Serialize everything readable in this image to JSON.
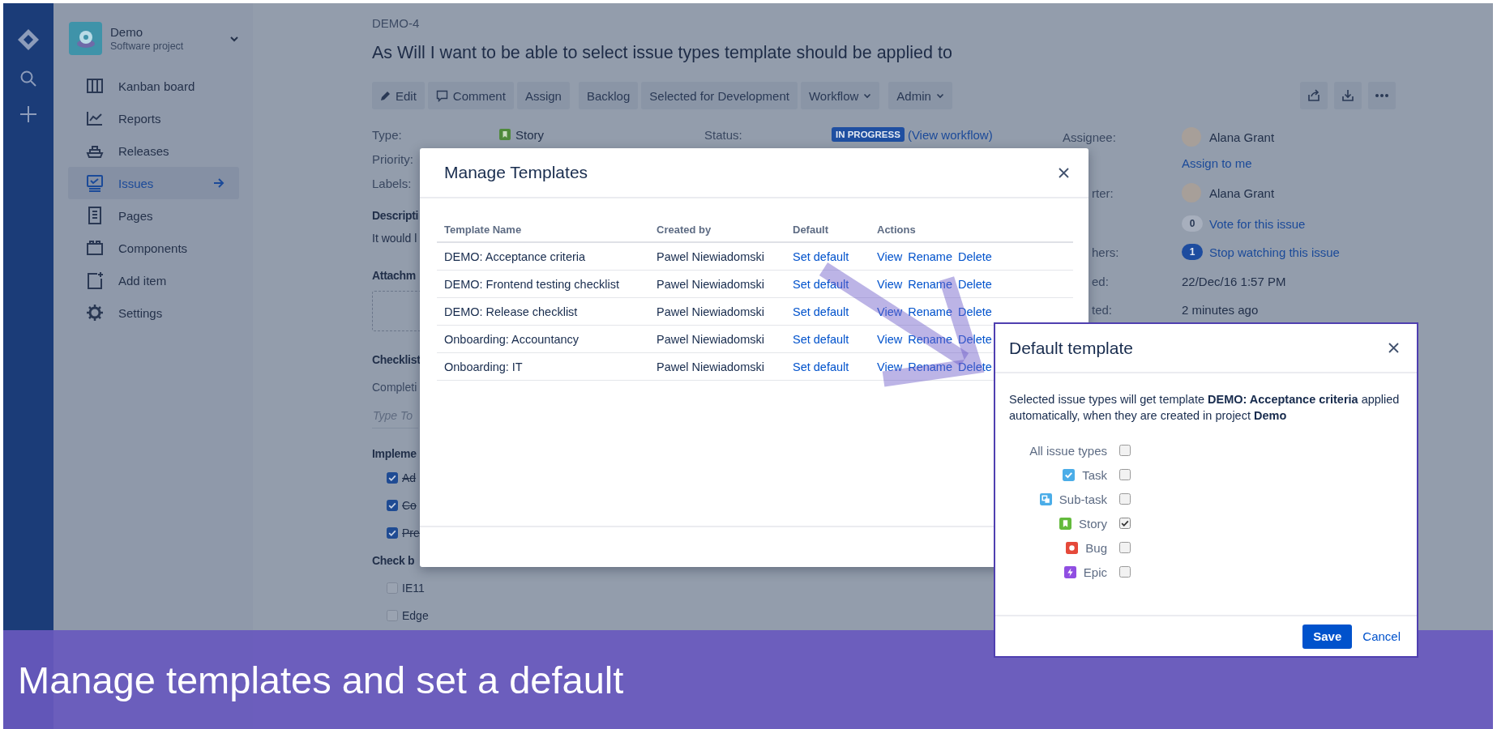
{
  "project": {
    "name": "Demo",
    "type": "Software project"
  },
  "sidebar": {
    "items": [
      {
        "label": "Kanban board",
        "selected": false
      },
      {
        "label": "Reports",
        "selected": false
      },
      {
        "label": "Releases",
        "selected": false
      },
      {
        "label": "Issues",
        "selected": true
      },
      {
        "label": "Pages",
        "selected": false
      },
      {
        "label": "Components",
        "selected": false
      },
      {
        "label": "Add item",
        "selected": false
      },
      {
        "label": "Settings",
        "selected": false
      }
    ]
  },
  "issue": {
    "key": "DEMO-4",
    "title": "As Will I want to be able to select issue types template should be applied to",
    "toolbar_groups": [
      [
        {
          "label": "Edit",
          "menu": false
        },
        {
          "label": "Comment",
          "menu": false
        },
        {
          "label": "Assign",
          "menu": false
        }
      ],
      [
        {
          "label": "Backlog",
          "menu": false
        },
        {
          "label": "Selected for Development",
          "menu": false
        },
        {
          "label": "Workflow",
          "menu": true
        }
      ],
      [
        {
          "label": "Admin",
          "menu": true
        }
      ]
    ],
    "details": [
      {
        "label": "Type:",
        "value": "Story"
      },
      {
        "label": "Priority:"
      },
      {
        "label": "Labels:"
      }
    ],
    "status": {
      "label": "Status:",
      "badge": "IN PROGRESS",
      "link": "(View workflow)"
    },
    "description": {
      "heading": "Descripti",
      "text": "It would l"
    },
    "attachments": {
      "heading": "Attachm"
    },
    "checklist": {
      "heading": "Checklist",
      "completion": "Completi",
      "placeholder": "Type To",
      "groups": [
        {
          "heading": "Impleme",
          "items": [
            {
              "label": "Ad",
              "checked": true
            },
            {
              "label": "Co",
              "checked": true
            },
            {
              "label": "Pre",
              "checked": true
            }
          ]
        },
        {
          "heading": "Check b",
          "items": [
            {
              "label": "IE11",
              "checked": false
            },
            {
              "label": "Edge",
              "checked": false
            }
          ]
        }
      ]
    },
    "people": [
      {
        "label": "Assignee:",
        "kind": "user",
        "value": "Alana Grant"
      },
      {
        "kind": "link",
        "value": "Assign to me"
      },
      {
        "label": "rter:",
        "kind": "user",
        "value": "Alana Grant"
      },
      {
        "kind": "count",
        "count": "0",
        "active": false,
        "value": "Vote for this issue"
      },
      {
        "label": "hers:",
        "kind": "count",
        "count": "1",
        "active": true,
        "value": "Stop watching this issue"
      },
      {
        "label": "ed:",
        "kind": "text",
        "value": "22/Dec/16 1:57 PM"
      },
      {
        "label": "ted:",
        "kind": "text",
        "value": "2 minutes ago"
      }
    ]
  },
  "manage_templates": {
    "title": "Manage Templates",
    "columns": [
      "Template Name",
      "Created by",
      "Default",
      "Actions"
    ],
    "rows": [
      {
        "name": "DEMO: Acceptance criteria",
        "created_by": "Pawel Niewiadomski",
        "default_link": "Set default",
        "actions": [
          "View",
          "Rename",
          "Delete"
        ]
      },
      {
        "name": "DEMO: Frontend testing checklist",
        "created_by": "Pawel Niewiadomski",
        "default_link": "Set default",
        "actions": [
          "View",
          "Rename",
          "Delete"
        ]
      },
      {
        "name": "DEMO: Release checklist",
        "created_by": "Pawel Niewiadomski",
        "default_link": "Set default",
        "actions": [
          "View",
          "Rename",
          "Delete"
        ]
      },
      {
        "name": "Onboarding: Accountancy",
        "created_by": "Pawel Niewiadomski",
        "default_link": "Set default",
        "actions": [
          "View",
          "Rename",
          "Delete"
        ]
      },
      {
        "name": "Onboarding: IT",
        "created_by": "Pawel Niewiadomski",
        "default_link": "Set default",
        "actions": [
          "View",
          "Rename",
          "Delete"
        ]
      }
    ]
  },
  "default_template": {
    "title": "Default template",
    "message": "Selected issue types will get template **DEMO: Acceptance criteria** applied automatically, when they are created in project **Demo**",
    "issue_types": [
      {
        "label": "All issue types",
        "kind": "all",
        "checked": false
      },
      {
        "label": "Task",
        "kind": "task",
        "color": "#4bade8",
        "checked": false
      },
      {
        "label": "Sub-task",
        "kind": "subtask",
        "color": "#4bade8",
        "checked": false
      },
      {
        "label": "Story",
        "kind": "story",
        "color": "#63ba3c",
        "checked": true
      },
      {
        "label": "Bug",
        "kind": "bug",
        "color": "#e5493a",
        "checked": false
      },
      {
        "label": "Epic",
        "kind": "epic",
        "color": "#904ee2",
        "checked": false
      }
    ],
    "buttons": [
      {
        "label": "Save",
        "kind": "primary"
      },
      {
        "label": "Cancel",
        "kind": "link"
      }
    ]
  },
  "caption": "Manage templates and set a default"
}
